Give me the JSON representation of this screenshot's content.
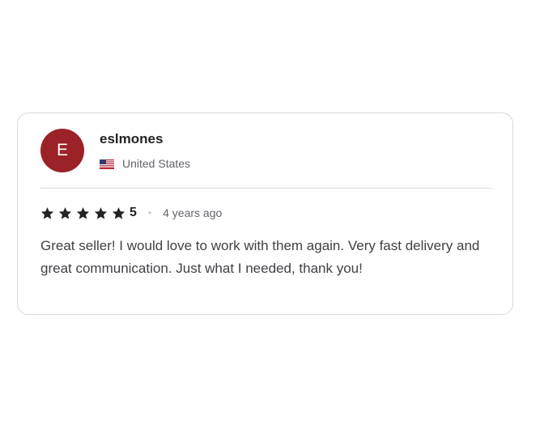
{
  "review": {
    "avatar_letter": "E",
    "avatar_color": "#9b2226",
    "username": "eslmones",
    "country": "United States",
    "country_flag_icon": "us-flag-icon",
    "rating_value": "5",
    "star_count": 5,
    "separator": "•",
    "time_ago": "4 years ago",
    "text": "Great seller! I would love to work with them again. Very fast delivery and great communication. Just what I needed, thank you!"
  }
}
